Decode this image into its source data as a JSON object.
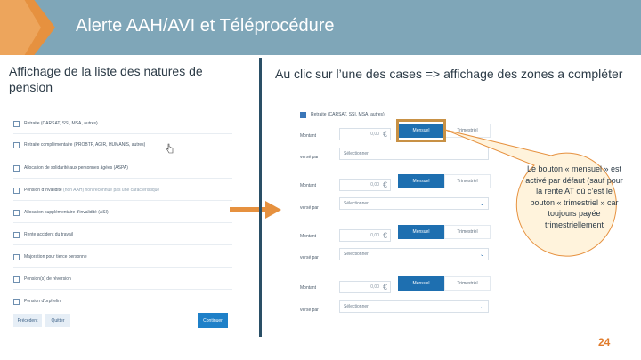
{
  "header": {
    "title": "Alerte AAH/AVI et Téléprocédure"
  },
  "left": {
    "caption": "Affichage de la liste des natures de pension",
    "items": [
      {
        "label": "Retraite (CARSAT, SSI, MSA, autres)",
        "checked": false
      },
      {
        "label": "Retraite complémentaire (PROBTP, AGIR, HUMANIS, autres)",
        "checked": false
      },
      {
        "label": "Allocation de solidarité aux personnes âgées (ASPA)",
        "checked": false
      },
      {
        "label": "Pension d'invalidité",
        "note": "(non AAH) non reconnue pas une caractéristique",
        "checked": false
      },
      {
        "label": "Allocation supplémentaire d'invalidité (ASI)",
        "checked": false
      },
      {
        "label": "Rente accident du travail",
        "checked": false
      },
      {
        "label": "Majoration pour tierce personne",
        "checked": false
      },
      {
        "label": "Pension(s) de réversion",
        "checked": false
      },
      {
        "label": "Pension d'orphelin",
        "checked": false
      }
    ],
    "buttons": {
      "previous": "Précédent",
      "quit": "Quitter",
      "continue": "Continuer"
    }
  },
  "right": {
    "caption": "Au clic sur l’une des cases => affichage des zones a compléter",
    "checked_item": "Retraite (CARSAT, SSI, MSA, autres)",
    "montant_label": "Montant",
    "verse_par_label": "versé par",
    "amount_value": "0,00",
    "currency": "€",
    "toggle_on": "Mensuel",
    "toggle_off": "Trimestriel",
    "select_placeholder": "Sélectionner"
  },
  "callout": {
    "text": "Le bouton « mensuel » est activé par défaut (sauf pour la rente AT où c’est le bouton « trimestriel » car toujours payée trimestriellement"
  },
  "page_number": "24",
  "colors": {
    "header": "#7fa6b8",
    "accent_orange": "#e6913f",
    "primary_blue": "#1e6fb0"
  }
}
